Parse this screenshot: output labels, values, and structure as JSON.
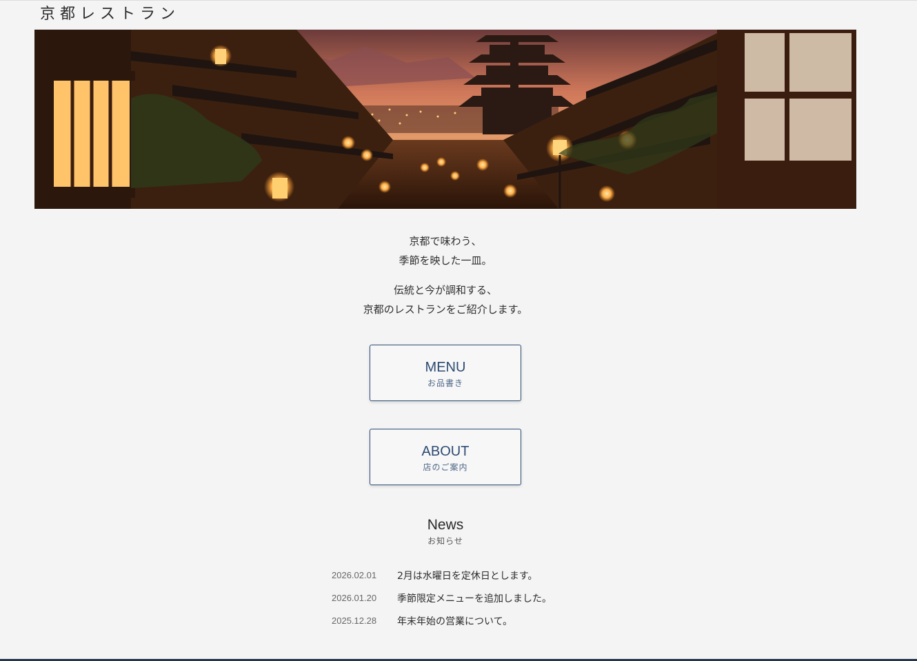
{
  "header": {
    "site_title": "京都レストラン"
  },
  "hero": {
    "image": "kyoto-night-street-pagoda-lanterns"
  },
  "intro": {
    "line1": "京都で味わう、",
    "line2": "季節を映した一皿。",
    "line3": "伝統と今が調和する、",
    "line4": "京都のレストランをご紹介します。"
  },
  "nav": {
    "menu": {
      "en": "MENU",
      "ja": "お品書き"
    },
    "about": {
      "en": "ABOUT",
      "ja": "店のご案内"
    }
  },
  "news": {
    "title_en": "News",
    "title_ja": "お知らせ",
    "items": [
      {
        "date": "2026.02.01",
        "text": "2月は水曜日を定休日とします。"
      },
      {
        "date": "2026.01.20",
        "text": "季節限定メニューを追加しました。"
      },
      {
        "date": "2025.12.28",
        "text": "年末年始の営業について。"
      }
    ]
  },
  "colors": {
    "accent": "#2c4a73",
    "background": "#f4f4f4",
    "footer_bar": "#23344d"
  }
}
